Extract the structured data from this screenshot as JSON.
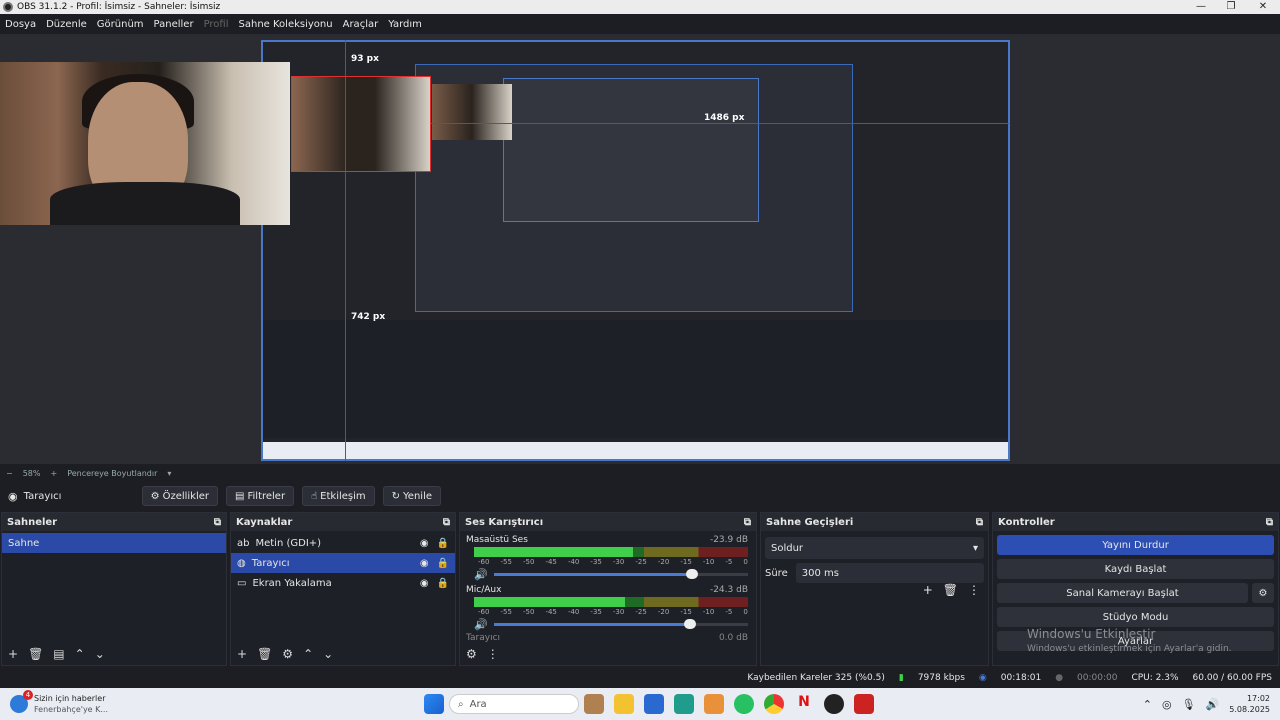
{
  "window": {
    "title": "OBS 31.1.2 - Profil: İsimsiz - Sahneler: İsimsiz"
  },
  "menu": [
    "Dosya",
    "Düzenle",
    "Görünüm",
    "Paneller",
    "Profil",
    "Sahne Koleksiyonu",
    "Araçlar",
    "Yardım"
  ],
  "menu_disabled": "Profil",
  "preview": {
    "px_labels": [
      "93 px",
      "1486 px",
      "742 px"
    ]
  },
  "zoom": {
    "minus": "−",
    "value": "58%",
    "plus": "+",
    "fit_label": "Pencereye Boyutlandır"
  },
  "source_toolbar": {
    "source_name": "Tarayıcı",
    "buttons": [
      "Özellikler",
      "Filtreler",
      "Etkileşim",
      "Yenile"
    ]
  },
  "scenes": {
    "title": "Sahneler",
    "items": [
      "Sahne"
    ]
  },
  "sources": {
    "title": "Kaynaklar",
    "items": [
      "Metin (GDI+)",
      "Tarayıcı",
      "Ekran Yakalama"
    ]
  },
  "mixer": {
    "title": "Ses Karıştırıcı",
    "channels": [
      {
        "name": "Masaüstü Ses",
        "db": "-23.9 dB",
        "level": 0.58,
        "volume": 0.78
      },
      {
        "name": "Mic/Aux",
        "db": "-24.3 dB",
        "level": 0.55,
        "volume": 0.77
      }
    ],
    "scale": [
      "-60",
      "-55",
      "-50",
      "-45",
      "-40",
      "-35",
      "-30",
      "-25",
      "-20",
      "-15",
      "-10",
      "-5",
      "0"
    ],
    "partial": {
      "name": "Tarayıcı",
      "db": "0.0 dB"
    }
  },
  "transitions": {
    "title": "Sahne Geçişleri",
    "type": "Soldur",
    "duration_label": "Süre",
    "duration": "300 ms"
  },
  "controls": {
    "title": "Kontroller",
    "buttons": [
      "Yayını Durdur",
      "Kaydı Başlat",
      "Sanal Kamerayı Başlat",
      "Stüdyo Modu",
      "Ayarlar"
    ],
    "watermark_title": "Windows'u Etkinleştir",
    "watermark_sub": "Windows'u etkinleştirmek için Ayarlar'a gidin."
  },
  "status": {
    "dropped": "Kaybedilen Kareler 325 (%0.5)",
    "bitrate": "7978 kbps",
    "stream_time": "00:18:01",
    "rec_time": "00:00:00",
    "cpu": "CPU: 2.3%",
    "fps": "60.00 / 60.00 FPS"
  },
  "taskbar": {
    "news_badge": "4",
    "news_title": "Sizin için haberler",
    "news_sub": "Fenerbahçe'ye K...",
    "search": "Ara",
    "time": "17:02",
    "date": "5.08.2025"
  },
  "colors": {
    "accent": "#2d4fb3",
    "red_guide": "#dd2222"
  }
}
